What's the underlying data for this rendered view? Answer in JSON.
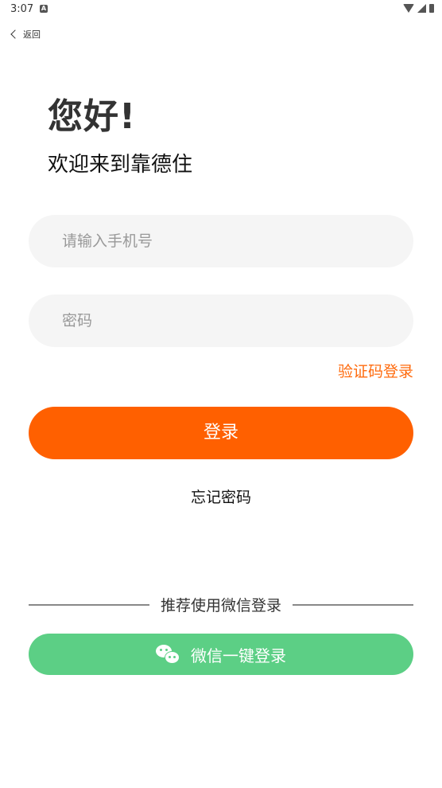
{
  "status_bar": {
    "time": "3:07",
    "notif_icon": "A"
  },
  "nav": {
    "back_label": "返回"
  },
  "header": {
    "greeting": "您好!",
    "welcome": "欢迎来到靠德住"
  },
  "form": {
    "phone_placeholder": "请输入手机号",
    "phone_value": "",
    "password_placeholder": "密码",
    "password_value": "",
    "code_login_link": "验证码登录",
    "login_button": "登录",
    "forgot_password": "忘记密码"
  },
  "wechat": {
    "divider_label": "推荐使用微信登录",
    "button_label": "微信一键登录"
  },
  "colors": {
    "accent": "#ff6000",
    "link": "#ff6b0e",
    "wechat": "#5ccf85"
  }
}
